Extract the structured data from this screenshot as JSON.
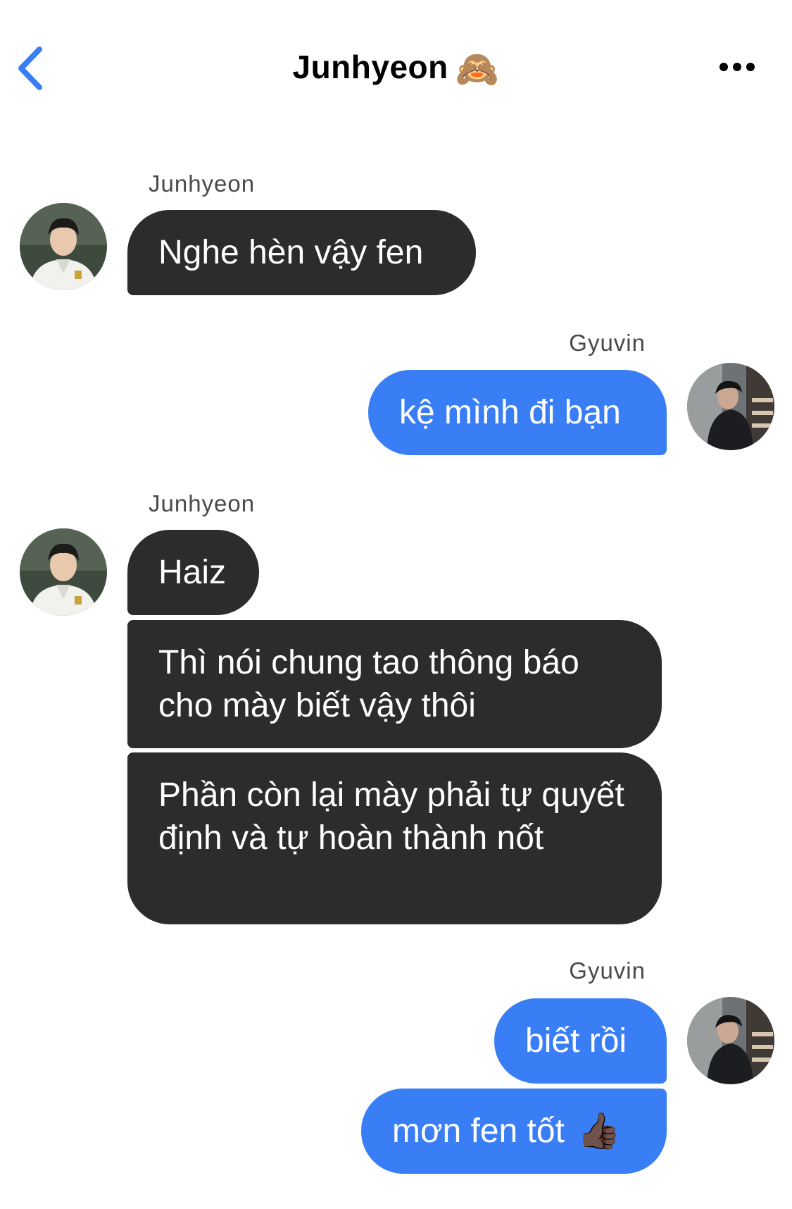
{
  "header": {
    "title": "Junhyeon",
    "title_emoji": "🙈",
    "back_icon": "chevron-left-icon",
    "more_icon": "ellipsis-icon"
  },
  "colors": {
    "accent": "#3a7ef5",
    "incoming_bubble": "#2c2c2e",
    "outgoing_bubble": "#3a7ef5",
    "background": "#ffffff"
  },
  "groups": [
    {
      "sender": "Junhyeon",
      "direction": "incoming",
      "messages": [
        "Nghe hèn vậy fen"
      ]
    },
    {
      "sender": "Gyuvin",
      "direction": "outgoing",
      "messages": [
        "kệ mình đi bạn"
      ]
    },
    {
      "sender": "Junhyeon",
      "direction": "incoming",
      "messages": [
        "Haiz",
        "Thì nói chung tao thông báo cho mày biết vậy thôi",
        "Phần còn lại mày phải tự quyết định và tự hoàn thành nốt"
      ]
    },
    {
      "sender": "Gyuvin",
      "direction": "outgoing",
      "messages": [
        "biết rồi",
        "mơn fen tốt"
      ],
      "trailing_emoji": "👍🏿"
    }
  ]
}
